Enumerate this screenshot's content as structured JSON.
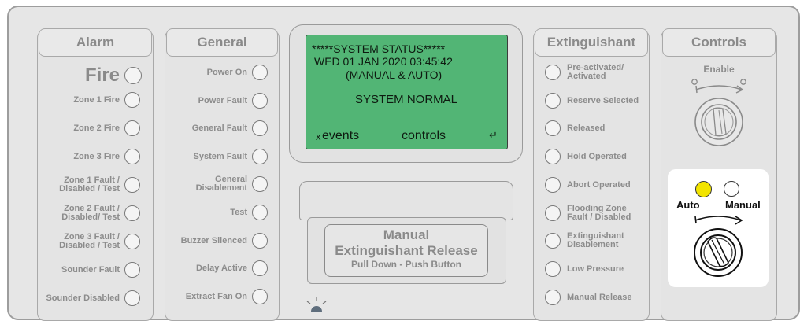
{
  "alarm": {
    "title": "Alarm",
    "fire": "Fire",
    "items": [
      "Zone 1 Fire",
      "Zone 2 Fire",
      "Zone 3 Fire",
      "Zone 1 Fault / Disabled / Test",
      "Zone 2 Fault / Disabled/ Test",
      "Zone 3 Fault / Disabled / Test",
      "Sounder Fault",
      "Sounder Disabled"
    ]
  },
  "general": {
    "title": "General",
    "items": [
      "Power On",
      "Power Fault",
      "General Fault",
      "System Fault",
      "General Disablement",
      "Test",
      "Buzzer Silenced",
      "Delay Active",
      "Extract Fan On"
    ]
  },
  "display": {
    "line1": "*****SYSTEM STATUS*****",
    "line2": "WED 01 JAN 2020 03:45:42",
    "line3": "(MANUAL & AUTO)",
    "line4": "SYSTEM NORMAL",
    "left_key": "events",
    "left_key_prefix": "x",
    "right_key": "controls",
    "enter_glyph": "↵",
    "bg_color": "#52b575"
  },
  "release": {
    "line1": "Manual",
    "line2": "Extinguishant Release",
    "line3": "Pull Down - Push Button"
  },
  "extinguishant": {
    "title": "Extinguishant",
    "items": [
      "Pre-activated/ Activated",
      "Reserve Selected",
      "Released",
      "Hold Operated",
      "Abort Operated",
      "Flooding Zone Fault / Disabled",
      "Extinguishant Disablement",
      "Low Pressure",
      "Manual Release"
    ]
  },
  "controls": {
    "title": "Controls",
    "enable": "Enable",
    "auto": "Auto",
    "manual": "Manual",
    "auto_led_color": "#f2e400"
  }
}
